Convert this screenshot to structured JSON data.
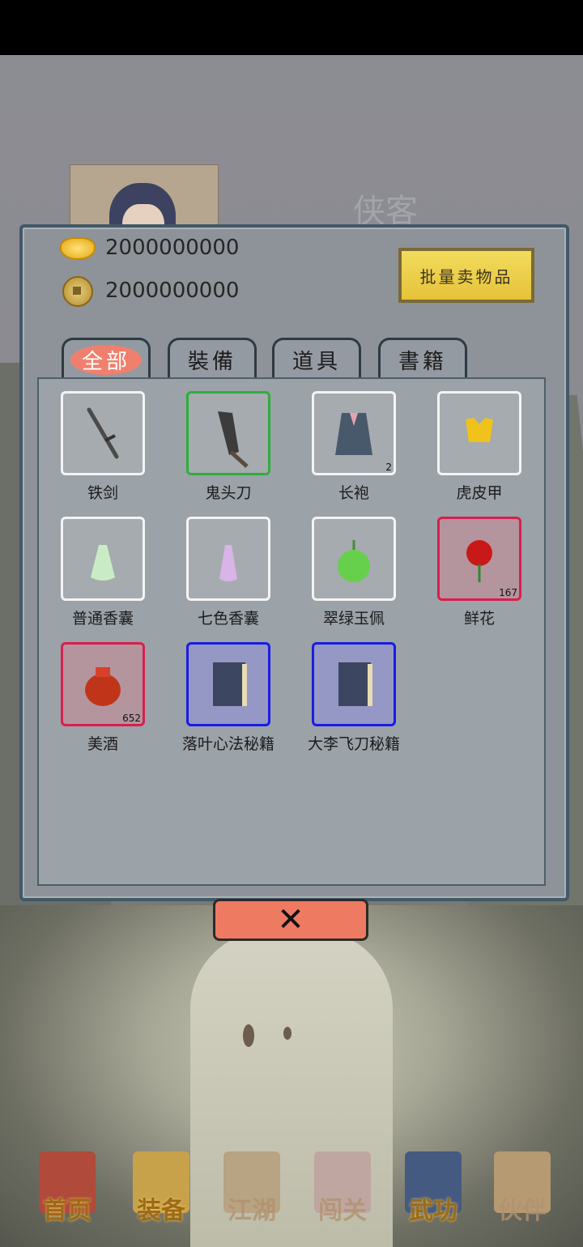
{
  "header": {
    "title": "侠客"
  },
  "currency": {
    "gold": "2000000000",
    "coins": "2000000000"
  },
  "bulk_sell_label": "批量卖物品",
  "tabs": [
    {
      "label": "全部",
      "active": true
    },
    {
      "label": "裝備",
      "active": false
    },
    {
      "label": "道具",
      "active": false
    },
    {
      "label": "書籍",
      "active": false
    }
  ],
  "items": [
    {
      "name": "铁剑",
      "icon": "iron-sword-icon",
      "rarity": "common",
      "count": ""
    },
    {
      "name": "鬼头刀",
      "icon": "ghost-head-sabre-icon",
      "rarity": "uncommon",
      "count": ""
    },
    {
      "name": "长袍",
      "icon": "robe-icon",
      "rarity": "common",
      "count": "2"
    },
    {
      "name": "虎皮甲",
      "icon": "tiger-armor-icon",
      "rarity": "common",
      "count": ""
    },
    {
      "name": "普通香囊",
      "icon": "sachet-icon",
      "rarity": "common",
      "count": ""
    },
    {
      "name": "七色香囊",
      "icon": "rainbow-sachet-icon",
      "rarity": "common",
      "count": ""
    },
    {
      "name": "翠绿玉佩",
      "icon": "jade-pendant-icon",
      "rarity": "common",
      "count": ""
    },
    {
      "name": "鲜花",
      "icon": "rose-icon",
      "rarity": "special",
      "count": "167"
    },
    {
      "name": "美酒",
      "icon": "wine-jar-icon",
      "rarity": "special",
      "count": "652"
    },
    {
      "name": "落叶心法秘籍",
      "icon": "manual-book-icon",
      "rarity": "rare",
      "count": ""
    },
    {
      "name": "大李飞刀秘籍",
      "icon": "manual-book-icon",
      "rarity": "rare",
      "count": ""
    }
  ],
  "close_label": "✕",
  "nav": [
    {
      "label": "首页",
      "icon": "home-icon",
      "active": true
    },
    {
      "label": "装备",
      "icon": "armor-icon",
      "active": true
    },
    {
      "label": "江湖",
      "icon": "map-scroll-icon",
      "active": false
    },
    {
      "label": "闯关",
      "icon": "gate-icon",
      "active": false
    },
    {
      "label": "武功",
      "icon": "martial-book-icon",
      "active": true
    },
    {
      "label": "伙伴",
      "icon": "companions-icon",
      "active": false
    }
  ],
  "colors": {
    "common_border": "#f4f4f4",
    "uncommon_border": "#2fae3a",
    "special_border": "#d91e4f",
    "rare_border": "#1a1ce3",
    "bulk_button": "#eed04a",
    "close_button": "#ef7a62"
  }
}
